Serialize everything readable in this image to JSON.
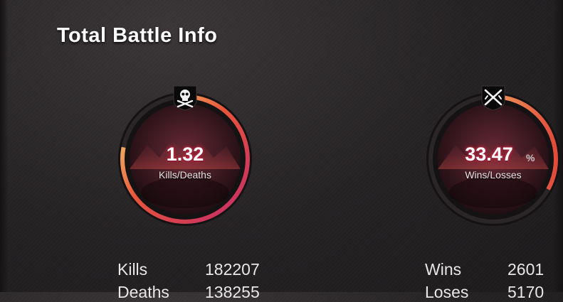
{
  "title": "Total Battle Info",
  "kd": {
    "value": "1.32",
    "label": "Kills/Deaths",
    "icon": "skull-crossbones-icon",
    "ratio": 0.78
  },
  "wl": {
    "value": "33.47",
    "unit": "%",
    "label": "Wins/Losses",
    "icon": "crossed-rifles-icon",
    "ratio": 0.33
  },
  "stats_left": [
    {
      "label": "Kills",
      "value": "182207"
    },
    {
      "label": "Deaths",
      "value": "138255"
    }
  ],
  "stats_right": [
    {
      "label": "Wins",
      "value": "2601"
    },
    {
      "label": "Loses",
      "value": "5170"
    }
  ],
  "colors": {
    "ring_start": "#d7325f",
    "ring_end": "#f2ea7a",
    "value_glow": "#e0304a"
  }
}
